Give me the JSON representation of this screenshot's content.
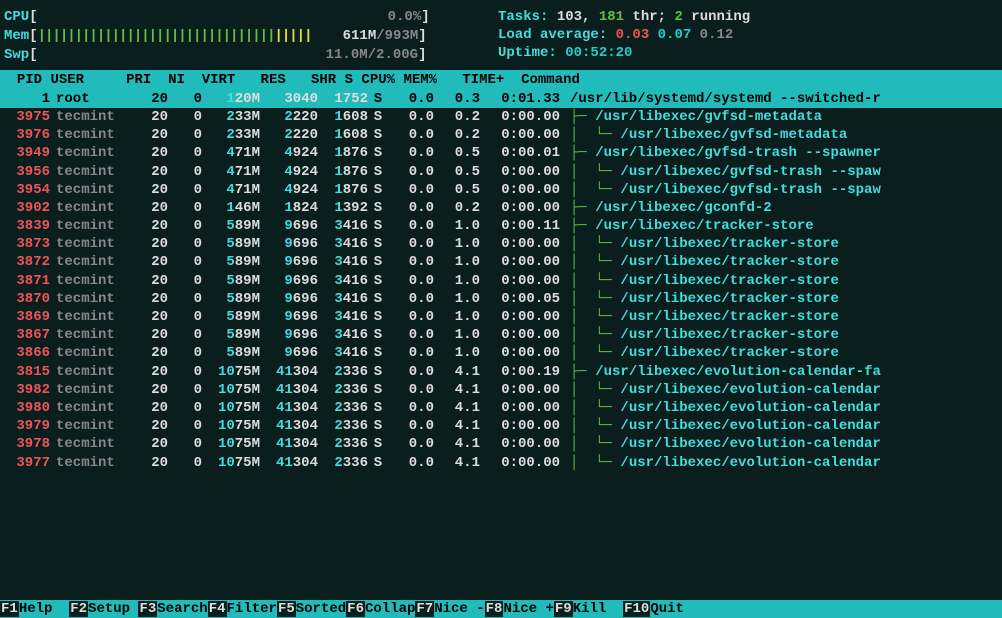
{
  "meters": {
    "cpu": {
      "label": "CPU",
      "value": "0.0%"
    },
    "mem": {
      "label": "Mem",
      "used": "611M",
      "total": "993M"
    },
    "swp": {
      "label": "Swp",
      "used": "11.0M",
      "total": "2.00G"
    }
  },
  "stats": {
    "tasks_label": "Tasks:",
    "tasks_procs": "103",
    "tasks_sep": ",",
    "tasks_threads": "181",
    "tasks_thr": " thr;",
    "tasks_running": "2",
    "tasks_running_lbl": " running",
    "load_label": "Load average:",
    "load1": "0.03",
    "load2": "0.07",
    "load3": "0.12",
    "uptime_label": "Uptime:",
    "uptime_value": "00:52:20"
  },
  "columns": {
    "pid": "PID",
    "user": "USER",
    "pri": "PRI",
    "ni": "NI",
    "virt": "VIRT",
    "res": "RES",
    "shr": "SHR",
    "s": "S",
    "cpu": "CPU%",
    "mem": "MEM%",
    "time": "TIME+",
    "cmd": "Command"
  },
  "rows": [
    {
      "pid": "1",
      "user": "root",
      "pri": "20",
      "ni": "0",
      "virt_l": "1",
      "virt_r": "20M",
      "res_l": "",
      "res_r": "3040",
      "shr_l": "",
      "shr_r": "1752",
      "s": "S",
      "cpu": "0.0",
      "mem": "0.3",
      "time": "0:01.33",
      "cmd": "/usr/lib/systemd/systemd --switched-r",
      "tree": 0,
      "sel": true
    },
    {
      "pid": "3975",
      "user": "tecmint",
      "pri": "20",
      "ni": "0",
      "virt_l": "2",
      "virt_r": "33M",
      "res_l": "2",
      "res_r": "220",
      "shr_l": "1",
      "shr_r": "608",
      "s": "S",
      "cpu": "0.0",
      "mem": "0.2",
      "time": "0:00.00",
      "cmd": "/usr/libexec/gvfsd-metadata",
      "tree": 1
    },
    {
      "pid": "3976",
      "user": "tecmint",
      "pri": "20",
      "ni": "0",
      "virt_l": "2",
      "virt_r": "33M",
      "res_l": "2",
      "res_r": "220",
      "shr_l": "1",
      "shr_r": "608",
      "s": "S",
      "cpu": "0.0",
      "mem": "0.2",
      "time": "0:00.00",
      "cmd": "/usr/libexec/gvfsd-metadata",
      "tree": 2
    },
    {
      "pid": "3949",
      "user": "tecmint",
      "pri": "20",
      "ni": "0",
      "virt_l": "4",
      "virt_r": "71M",
      "res_l": "4",
      "res_r": "924",
      "shr_l": "1",
      "shr_r": "876",
      "s": "S",
      "cpu": "0.0",
      "mem": "0.5",
      "time": "0:00.01",
      "cmd": "/usr/libexec/gvfsd-trash --spawner",
      "tree": 1
    },
    {
      "pid": "3956",
      "user": "tecmint",
      "pri": "20",
      "ni": "0",
      "virt_l": "4",
      "virt_r": "71M",
      "res_l": "4",
      "res_r": "924",
      "shr_l": "1",
      "shr_r": "876",
      "s": "S",
      "cpu": "0.0",
      "mem": "0.5",
      "time": "0:00.00",
      "cmd": "/usr/libexec/gvfsd-trash --spaw",
      "tree": 2
    },
    {
      "pid": "3954",
      "user": "tecmint",
      "pri": "20",
      "ni": "0",
      "virt_l": "4",
      "virt_r": "71M",
      "res_l": "4",
      "res_r": "924",
      "shr_l": "1",
      "shr_r": "876",
      "s": "S",
      "cpu": "0.0",
      "mem": "0.5",
      "time": "0:00.00",
      "cmd": "/usr/libexec/gvfsd-trash --spaw",
      "tree": 2
    },
    {
      "pid": "3902",
      "user": "tecmint",
      "pri": "20",
      "ni": "0",
      "virt_l": "1",
      "virt_r": "46M",
      "res_l": "1",
      "res_r": "824",
      "shr_l": "1",
      "shr_r": "392",
      "s": "S",
      "cpu": "0.0",
      "mem": "0.2",
      "time": "0:00.00",
      "cmd": "/usr/libexec/gconfd-2",
      "tree": 1
    },
    {
      "pid": "3839",
      "user": "tecmint",
      "pri": "20",
      "ni": "0",
      "virt_l": "5",
      "virt_r": "89M",
      "res_l": "9",
      "res_r": "696",
      "shr_l": "3",
      "shr_r": "416",
      "s": "S",
      "cpu": "0.0",
      "mem": "1.0",
      "time": "0:00.11",
      "cmd": "/usr/libexec/tracker-store",
      "tree": 1
    },
    {
      "pid": "3873",
      "user": "tecmint",
      "pri": "20",
      "ni": "0",
      "virt_l": "5",
      "virt_r": "89M",
      "res_l": "9",
      "res_r": "696",
      "shr_l": "3",
      "shr_r": "416",
      "s": "S",
      "cpu": "0.0",
      "mem": "1.0",
      "time": "0:00.00",
      "cmd": "/usr/libexec/tracker-store",
      "tree": 2
    },
    {
      "pid": "3872",
      "user": "tecmint",
      "pri": "20",
      "ni": "0",
      "virt_l": "5",
      "virt_r": "89M",
      "res_l": "9",
      "res_r": "696",
      "shr_l": "3",
      "shr_r": "416",
      "s": "S",
      "cpu": "0.0",
      "mem": "1.0",
      "time": "0:00.00",
      "cmd": "/usr/libexec/tracker-store",
      "tree": 2
    },
    {
      "pid": "3871",
      "user": "tecmint",
      "pri": "20",
      "ni": "0",
      "virt_l": "5",
      "virt_r": "89M",
      "res_l": "9",
      "res_r": "696",
      "shr_l": "3",
      "shr_r": "416",
      "s": "S",
      "cpu": "0.0",
      "mem": "1.0",
      "time": "0:00.00",
      "cmd": "/usr/libexec/tracker-store",
      "tree": 2
    },
    {
      "pid": "3870",
      "user": "tecmint",
      "pri": "20",
      "ni": "0",
      "virt_l": "5",
      "virt_r": "89M",
      "res_l": "9",
      "res_r": "696",
      "shr_l": "3",
      "shr_r": "416",
      "s": "S",
      "cpu": "0.0",
      "mem": "1.0",
      "time": "0:00.05",
      "cmd": "/usr/libexec/tracker-store",
      "tree": 2
    },
    {
      "pid": "3869",
      "user": "tecmint",
      "pri": "20",
      "ni": "0",
      "virt_l": "5",
      "virt_r": "89M",
      "res_l": "9",
      "res_r": "696",
      "shr_l": "3",
      "shr_r": "416",
      "s": "S",
      "cpu": "0.0",
      "mem": "1.0",
      "time": "0:00.00",
      "cmd": "/usr/libexec/tracker-store",
      "tree": 2
    },
    {
      "pid": "3867",
      "user": "tecmint",
      "pri": "20",
      "ni": "0",
      "virt_l": "5",
      "virt_r": "89M",
      "res_l": "9",
      "res_r": "696",
      "shr_l": "3",
      "shr_r": "416",
      "s": "S",
      "cpu": "0.0",
      "mem": "1.0",
      "time": "0:00.00",
      "cmd": "/usr/libexec/tracker-store",
      "tree": 2
    },
    {
      "pid": "3866",
      "user": "tecmint",
      "pri": "20",
      "ni": "0",
      "virt_l": "5",
      "virt_r": "89M",
      "res_l": "9",
      "res_r": "696",
      "shr_l": "3",
      "shr_r": "416",
      "s": "S",
      "cpu": "0.0",
      "mem": "1.0",
      "time": "0:00.00",
      "cmd": "/usr/libexec/tracker-store",
      "tree": 2
    },
    {
      "pid": "3815",
      "user": "tecmint",
      "pri": "20",
      "ni": "0",
      "virt_l": "10",
      "virt_r": "75M",
      "res_l": "41",
      "res_r": "304",
      "shr_l": "2",
      "shr_r": "336",
      "s": "S",
      "cpu": "0.0",
      "mem": "4.1",
      "time": "0:00.19",
      "cmd": "/usr/libexec/evolution-calendar-fa",
      "tree": 1
    },
    {
      "pid": "3982",
      "user": "tecmint",
      "pri": "20",
      "ni": "0",
      "virt_l": "10",
      "virt_r": "75M",
      "res_l": "41",
      "res_r": "304",
      "shr_l": "2",
      "shr_r": "336",
      "s": "S",
      "cpu": "0.0",
      "mem": "4.1",
      "time": "0:00.00",
      "cmd": "/usr/libexec/evolution-calendar",
      "tree": 2
    },
    {
      "pid": "3980",
      "user": "tecmint",
      "pri": "20",
      "ni": "0",
      "virt_l": "10",
      "virt_r": "75M",
      "res_l": "41",
      "res_r": "304",
      "shr_l": "2",
      "shr_r": "336",
      "s": "S",
      "cpu": "0.0",
      "mem": "4.1",
      "time": "0:00.00",
      "cmd": "/usr/libexec/evolution-calendar",
      "tree": 2
    },
    {
      "pid": "3979",
      "user": "tecmint",
      "pri": "20",
      "ni": "0",
      "virt_l": "10",
      "virt_r": "75M",
      "res_l": "41",
      "res_r": "304",
      "shr_l": "2",
      "shr_r": "336",
      "s": "S",
      "cpu": "0.0",
      "mem": "4.1",
      "time": "0:00.00",
      "cmd": "/usr/libexec/evolution-calendar",
      "tree": 2
    },
    {
      "pid": "3978",
      "user": "tecmint",
      "pri": "20",
      "ni": "0",
      "virt_l": "10",
      "virt_r": "75M",
      "res_l": "41",
      "res_r": "304",
      "shr_l": "2",
      "shr_r": "336",
      "s": "S",
      "cpu": "0.0",
      "mem": "4.1",
      "time": "0:00.00",
      "cmd": "/usr/libexec/evolution-calendar",
      "tree": 2
    },
    {
      "pid": "3977",
      "user": "tecmint",
      "pri": "20",
      "ni": "0",
      "virt_l": "10",
      "virt_r": "75M",
      "res_l": "41",
      "res_r": "304",
      "shr_l": "2",
      "shr_r": "336",
      "s": "S",
      "cpu": "0.0",
      "mem": "4.1",
      "time": "0:00.00",
      "cmd": "/usr/libexec/evolution-calendar",
      "tree": 2
    }
  ],
  "footer": [
    {
      "key": "F1",
      "label": "Help  "
    },
    {
      "key": "F2",
      "label": "Setup "
    },
    {
      "key": "F3",
      "label": "Search"
    },
    {
      "key": "F4",
      "label": "Filter"
    },
    {
      "key": "F5",
      "label": "Sorted"
    },
    {
      "key": "F6",
      "label": "Collap"
    },
    {
      "key": "F7",
      "label": "Nice -"
    },
    {
      "key": "F8",
      "label": "Nice +"
    },
    {
      "key": "F9",
      "label": "Kill  "
    },
    {
      "key": "F10",
      "label": "Quit"
    }
  ]
}
